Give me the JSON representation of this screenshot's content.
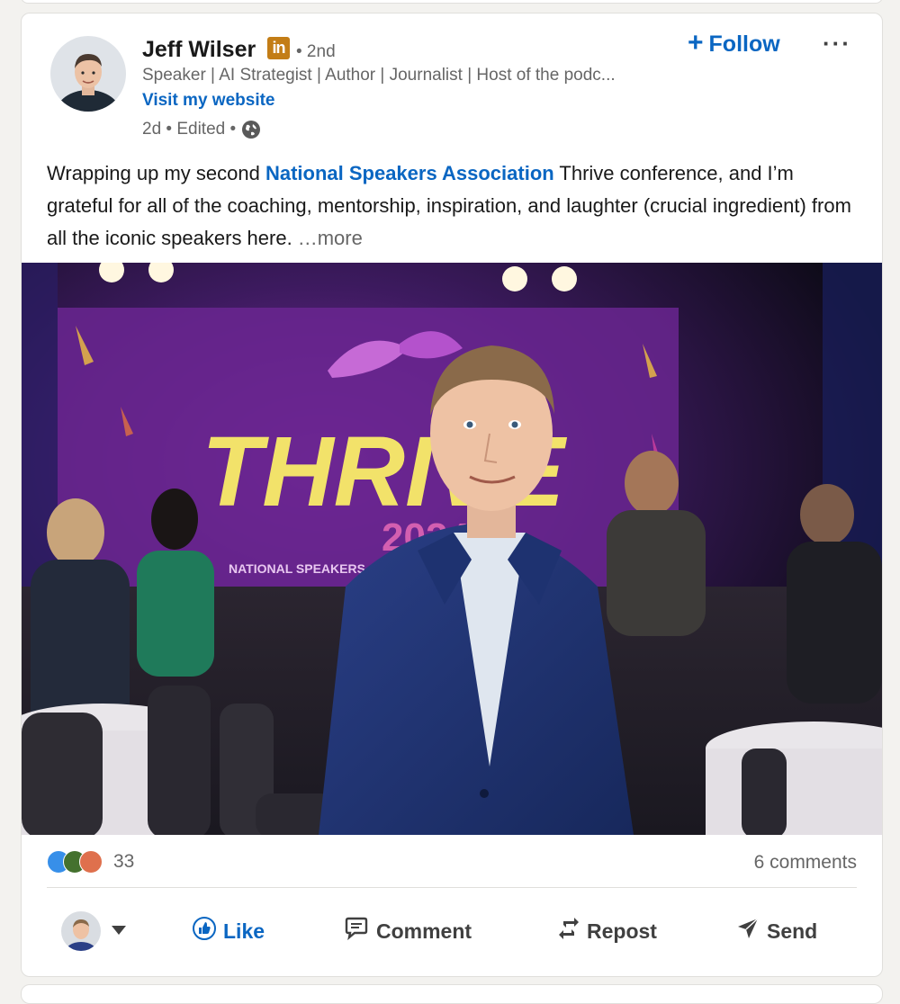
{
  "post": {
    "author": {
      "name": "Jeff Wilser",
      "badge": "in",
      "degree": "• 2nd",
      "headline": "Speaker | AI Strategist | Author | Journalist | Host of the podc...",
      "website_label": "Visit my website",
      "meta": "2d • Edited •"
    },
    "follow_label": "Follow",
    "follow_icon": "+",
    "more_icon": "···",
    "text": {
      "part1": "Wrapping up my second ",
      "mention": "National Speakers Association",
      "part2": " Thrive conference, and I’m grateful for all of the coaching, mentorship, inspiration, and laughter (crucial ingredient) from all the iconic speakers here.",
      "see_more": "…more"
    },
    "image": {
      "banner_text": "THRIVE",
      "banner_year": "2024",
      "banner_sub": "NATIONAL SPEAKERS ASSOCIATION"
    },
    "social": {
      "reaction_count": "33",
      "comments": "6 comments"
    },
    "actions": {
      "like": "Like",
      "comment": "Comment",
      "repost": "Repost",
      "send": "Send"
    }
  },
  "colors": {
    "accent": "#0a66c2",
    "badge": "#c37d16",
    "muted": "#666666"
  }
}
